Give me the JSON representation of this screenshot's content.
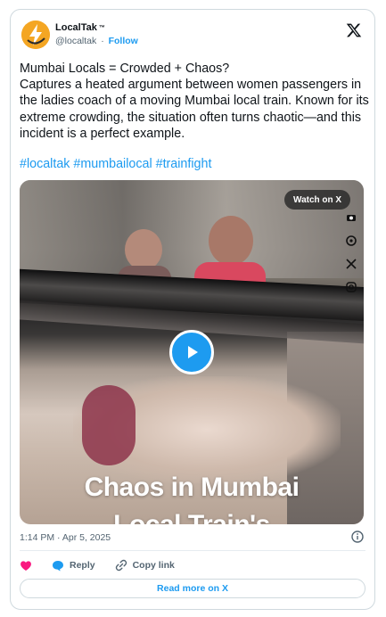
{
  "author": {
    "name": "LocalTak",
    "trademark": "™",
    "handle": "@localtak",
    "separator": "·",
    "follow_label": "Follow"
  },
  "tweet": {
    "text": "Mumbai Locals = Crowded + Chaos?\nCaptures a heated argument between women passengers in the ladies coach of a moving Mumbai local train. Known for its extreme crowding, the situation often turns chaotic—and this incident is a perfect example.",
    "hashtags": [
      "#localtak",
      "#mumbailocal",
      "#trainfight"
    ]
  },
  "video": {
    "watch_label": "Watch on X",
    "caption_line1": "Chaos in Mumbai",
    "caption_line2": "Local Train's"
  },
  "meta": {
    "timestamp": "1:14 PM · Apr 5, 2025"
  },
  "actions": {
    "reply_label": "Reply",
    "copy_link_label": "Copy link"
  },
  "read_more_label": "Read more on X",
  "colors": {
    "accent": "#1d9bf0",
    "like": "#f91880",
    "text": "#0f1419",
    "muted": "#536471",
    "avatar": "#f4a623"
  },
  "icons": [
    "lightning-logo-icon",
    "x-logo-icon",
    "play-icon",
    "heart-icon",
    "reply-bubble-icon",
    "link-icon",
    "info-icon"
  ]
}
